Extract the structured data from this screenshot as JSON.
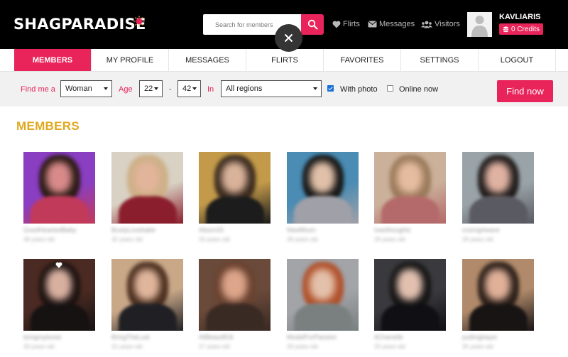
{
  "header": {
    "logo": "SHAGPARADISE",
    "search_placeholder": "Search for members",
    "nav": [
      {
        "label": "Flirts",
        "icon": "heart-icon"
      },
      {
        "label": "Messages",
        "icon": "envelope-icon"
      },
      {
        "label": "Visitors",
        "icon": "users-icon"
      }
    ],
    "username": "KAVLIARIS",
    "credits": "0 Credits"
  },
  "tabs": [
    "MEMBERS",
    "MY PROFILE",
    "MESSAGES",
    "FLIRTS",
    "FAVORITES",
    "SETTINGS",
    "LOGOUT"
  ],
  "active_tab": "MEMBERS",
  "filter": {
    "find_label": "Find me a",
    "gender": "Woman",
    "age_label": "Age",
    "age_min": "22",
    "age_dash": "-",
    "age_max": "42",
    "in_label": "In",
    "region": "All regions",
    "with_photo_label": "With photo",
    "with_photo_checked": true,
    "online_now_label": "Online now",
    "online_now_checked": false,
    "find_button": "Find now"
  },
  "members_title": "MEMBERS",
  "colors": {
    "accent": "#e8245a",
    "title": "#e0a81d",
    "header_bg": "#000000",
    "filter_bg": "#f1f1f1"
  },
  "members": [
    {
      "name": "GoodHeartedBaby",
      "age": "36 years old",
      "bg": "#8a3ec2",
      "skin": "#d88a8a",
      "hair": "#2a1a14",
      "top": "#c23a5a"
    },
    {
      "name": "BustyLovebabe",
      "age": "32 years old",
      "bg": "#d9d2c4",
      "skin": "#e2b49a",
      "hair": "#cdb088",
      "top": "#8b1e2c"
    },
    {
      "name": "Alison33",
      "age": "33 years old",
      "bg": "#c39a4a",
      "skin": "#d9b29a",
      "hair": "#3a2a1e",
      "top": "#1c1c1c"
    },
    {
      "name": "NewMoon",
      "age": "28 years old",
      "bg": "#4a8cb3",
      "skin": "#e0c0a8",
      "hair": "#151515",
      "top": "#a0a0a8"
    },
    {
      "name": "Ivanthoughts",
      "age": "29 years old",
      "bg": "#cbb09a",
      "skin": "#e6bca0",
      "hair": "#9a7a5a",
      "top": "#b46a6a"
    },
    {
      "name": "cosmgrlwave",
      "age": "34 years old",
      "bg": "#9aa4a8",
      "skin": "#e0b2a2",
      "hair": "#1e1a1a",
      "top": "#5a5a62"
    },
    {
      "name": "bringmyloose",
      "age": "30 years old",
      "bg": "#4a2a22",
      "skin": "#d8b0a0",
      "hair": "#1c1210",
      "top": "#161212"
    },
    {
      "name": "BringTheLust",
      "age": "31 years old",
      "bg": "#c9a888",
      "skin": "#dfb59c",
      "hair": "#4a2e1e",
      "top": "#202024"
    },
    {
      "name": "AllBeautifUli",
      "age": "27 years old",
      "bg": "#6a4a3a",
      "skin": "#dda58a",
      "hair": "#6a4230",
      "top": "#3a2a24"
    },
    {
      "name": "ModelForPassion",
      "age": "29 years old",
      "bg": "#a2a4a8",
      "skin": "#e3c0aa",
      "hair": "#b0502a",
      "top": "#7a8080"
    },
    {
      "name": "ItChanelle",
      "age": "33 years old",
      "bg": "#3a3a3e",
      "skin": "#e2c0b0",
      "hair": "#141414",
      "top": "#101014"
    },
    {
      "name": "puttingbayer",
      "age": "35 years old",
      "bg": "#b08a6a",
      "skin": "#e0b098",
      "hair": "#2a1e18",
      "top": "#181414"
    }
  ]
}
